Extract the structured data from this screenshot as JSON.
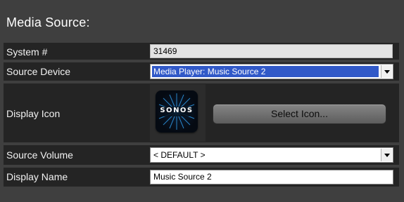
{
  "panel": {
    "title": "Media Source:"
  },
  "fields": {
    "system_number": {
      "label": "System #",
      "value": "31469"
    },
    "source_device": {
      "label": "Source Device",
      "value": "Media Player: Music Source 2"
    },
    "display_icon": {
      "label": "Display Icon",
      "icon_text": "SONOS",
      "button_label": "Select Icon..."
    },
    "source_volume": {
      "label": "Source Volume",
      "value": "< DEFAULT >"
    },
    "display_name": {
      "label": "Display Name",
      "value": "Music Source 2"
    }
  },
  "colors": {
    "background": "#3f3f3f",
    "row_background": "#242424",
    "selection_highlight": "#3159c8"
  }
}
